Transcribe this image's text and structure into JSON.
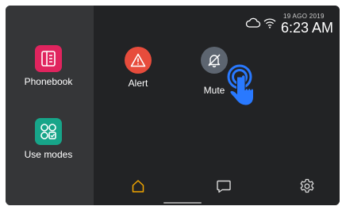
{
  "sidebar": {
    "apps": [
      {
        "label": "Phonebook",
        "icon": "phonebook-icon",
        "color": "#e0245e"
      },
      {
        "label": "Use modes",
        "icon": "use-modes-icon",
        "color": "#17a589"
      }
    ]
  },
  "status": {
    "date": "19 AGO 2019",
    "time": "6:23 AM",
    "icons": [
      "cloud-icon",
      "wifi-icon"
    ]
  },
  "tiles": [
    {
      "label": "Alert",
      "icon": "alert-icon",
      "color": "#e74c3c"
    },
    {
      "label": "Mute",
      "icon": "bell-muted-icon",
      "color": "#5d6570"
    }
  ],
  "nav": {
    "items": [
      {
        "name": "home",
        "icon": "home-icon",
        "active": true,
        "color": "#f0a500"
      },
      {
        "name": "messages",
        "icon": "message-icon",
        "active": false,
        "color": "#d8d8d8"
      },
      {
        "name": "settings",
        "icon": "gear-icon",
        "active": false,
        "color": "#d8d8d8"
      }
    ]
  },
  "theme": {
    "accent": "#2979ff",
    "background": "#222325",
    "sidebar": "#353638"
  }
}
